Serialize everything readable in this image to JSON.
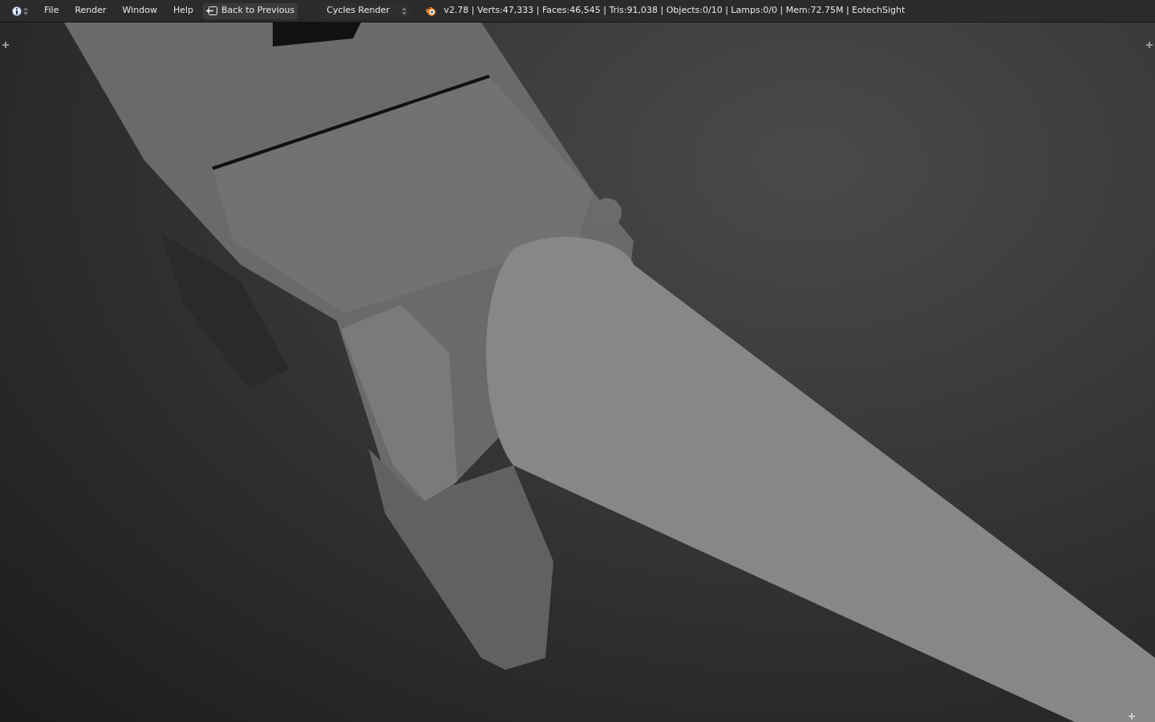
{
  "header": {
    "menus": [
      "File",
      "Render",
      "Window",
      "Help"
    ],
    "back_button": "Back to Previous",
    "render_engine": "Cycles Render",
    "stats": "v2.78 | Verts:47,333 | Faces:46,545 | Tris:91,038 | Objects:0/10 | Lamps:0/0 | Mem:72.75M | EotechSight"
  }
}
